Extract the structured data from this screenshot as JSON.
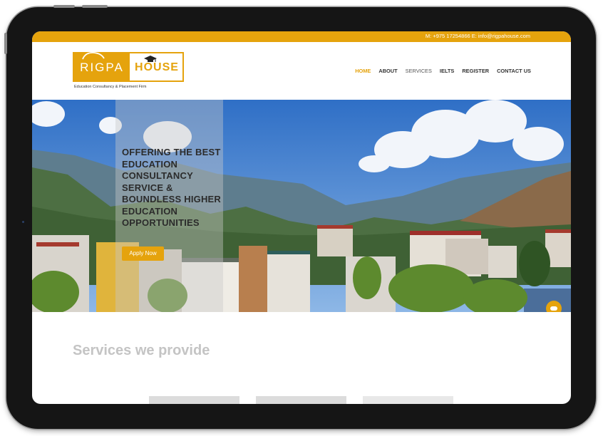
{
  "topbar": {
    "contact": "M: +975 17254866 E: info@rigpahouse.com"
  },
  "logo": {
    "left_text": "RIGPA",
    "right_text": "HOUSE",
    "tagline": "Education Consultancy & Placement Firm"
  },
  "nav": {
    "items": [
      "HOME",
      "ABOUT",
      "SERVICES",
      "IELTS",
      "REGISTER",
      "CONTACT US"
    ],
    "active": "HOME"
  },
  "hero": {
    "title": "OFFERING THE BEST EDUCATION CONSULTANCY SERVICE & BOUNDLESS HIGHER EDUCATION OPPORTUNITIES",
    "button": "Apply Now"
  },
  "services": {
    "title": "Services we provide"
  },
  "colors": {
    "accent": "#e5a30d",
    "frame": "#151515",
    "heading_gray": "#c4c4c4"
  },
  "icons": [
    "graduation-cap-icon",
    "chat-icon"
  ]
}
